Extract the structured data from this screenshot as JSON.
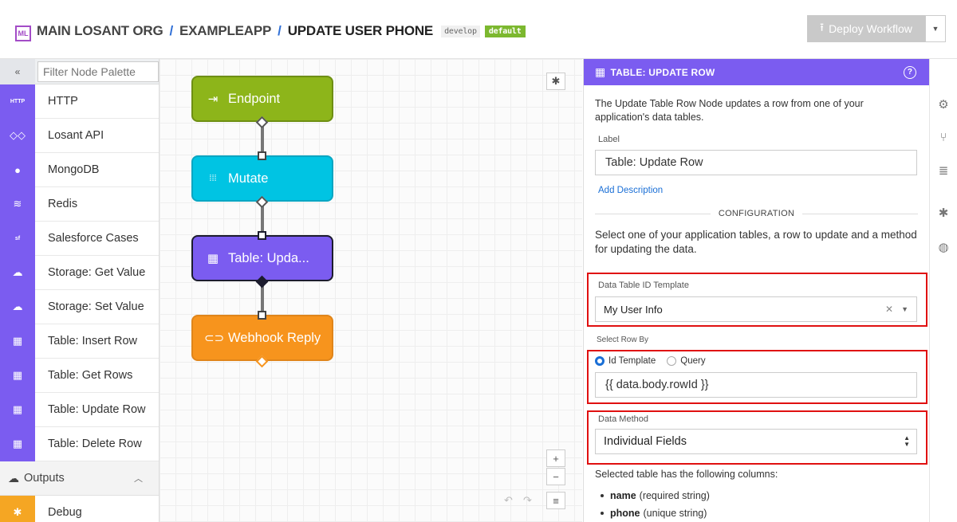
{
  "header": {
    "logo_text": "ML",
    "org": "MAIN LOSANT ORG",
    "app": "EXAMPLEAPP",
    "workflow": "UPDATE USER PHONE",
    "version_tag": "develop",
    "default_tag": "default",
    "deploy_label": "Deploy Workflow",
    "separator": "/"
  },
  "palette": {
    "filter_placeholder": "Filter Node Palette",
    "collapse_icon": "«",
    "items": [
      {
        "label": "HTTP",
        "icon": "http-icon",
        "icon_text": "HTTP"
      },
      {
        "label": "Losant API",
        "icon": "losant-api-icon"
      },
      {
        "label": "MongoDB",
        "icon": "mongodb-icon"
      },
      {
        "label": "Redis",
        "icon": "redis-icon"
      },
      {
        "label": "Salesforce Cases",
        "icon": "salesforce-icon",
        "icon_text": "sf"
      },
      {
        "label": "Storage: Get Value",
        "icon": "cloud-download-icon"
      },
      {
        "label": "Storage: Set Value",
        "icon": "cloud-upload-icon"
      },
      {
        "label": "Table: Insert Row",
        "icon": "table-insert-icon"
      },
      {
        "label": "Table: Get Rows",
        "icon": "table-get-icon"
      },
      {
        "label": "Table: Update Row",
        "icon": "table-update-icon"
      },
      {
        "label": "Table: Delete Row",
        "icon": "table-delete-icon"
      }
    ],
    "outputs_section": "Outputs",
    "debug_item": "Debug"
  },
  "canvas": {
    "nodes": [
      {
        "label": "Endpoint",
        "icon": "endpoint-icon"
      },
      {
        "label": "Mutate",
        "icon": "mutate-icon"
      },
      {
        "label": "Table: Upda...",
        "icon": "table-icon"
      },
      {
        "label": "Webhook Reply",
        "icon": "link-icon"
      }
    ],
    "zoom_in": "+",
    "zoom_out": "−"
  },
  "panel": {
    "title": "TABLE: UPDATE ROW",
    "description": "The Update Table Row Node updates a row from one of your application's data tables.",
    "label_field_label": "Label",
    "label_field_value": "Table: Update Row",
    "add_description": "Add Description",
    "configuration_heading": "CONFIGURATION",
    "config_description": "Select one of your application tables, a row to update and a method for updating the data.",
    "data_table_label": "Data Table ID Template",
    "data_table_value": "My User Info",
    "select_row_label": "Select Row By",
    "radio_id": "Id Template",
    "radio_query": "Query",
    "row_id_value": "{{ data.body.rowId }}",
    "data_method_label": "Data Method",
    "data_method_value": "Individual Fields",
    "columns_title": "Selected table has the following columns:",
    "columns": [
      {
        "name": "name",
        "desc": "(required string)"
      },
      {
        "name": "phone",
        "desc": "(unique string)"
      }
    ],
    "accent_color": "#7b5cf0",
    "highlight_color": "#e01010"
  }
}
